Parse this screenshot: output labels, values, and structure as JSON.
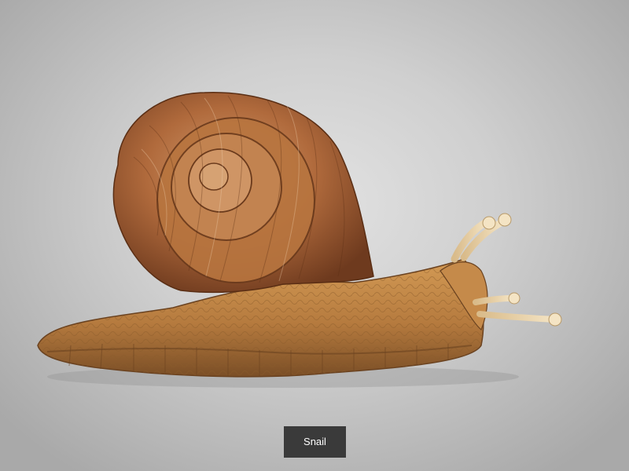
{
  "viewer": {
    "background_color": "#c8c8c8",
    "caption": "Snail",
    "caption_background": "#3a3a3a",
    "caption_color": "#ffffff"
  },
  "model": {
    "subject_icon": "snail-3d-model",
    "shell_color": "#b06a3c",
    "body_color": "#c58a4a",
    "tentacle_color": "#efdcb8"
  }
}
